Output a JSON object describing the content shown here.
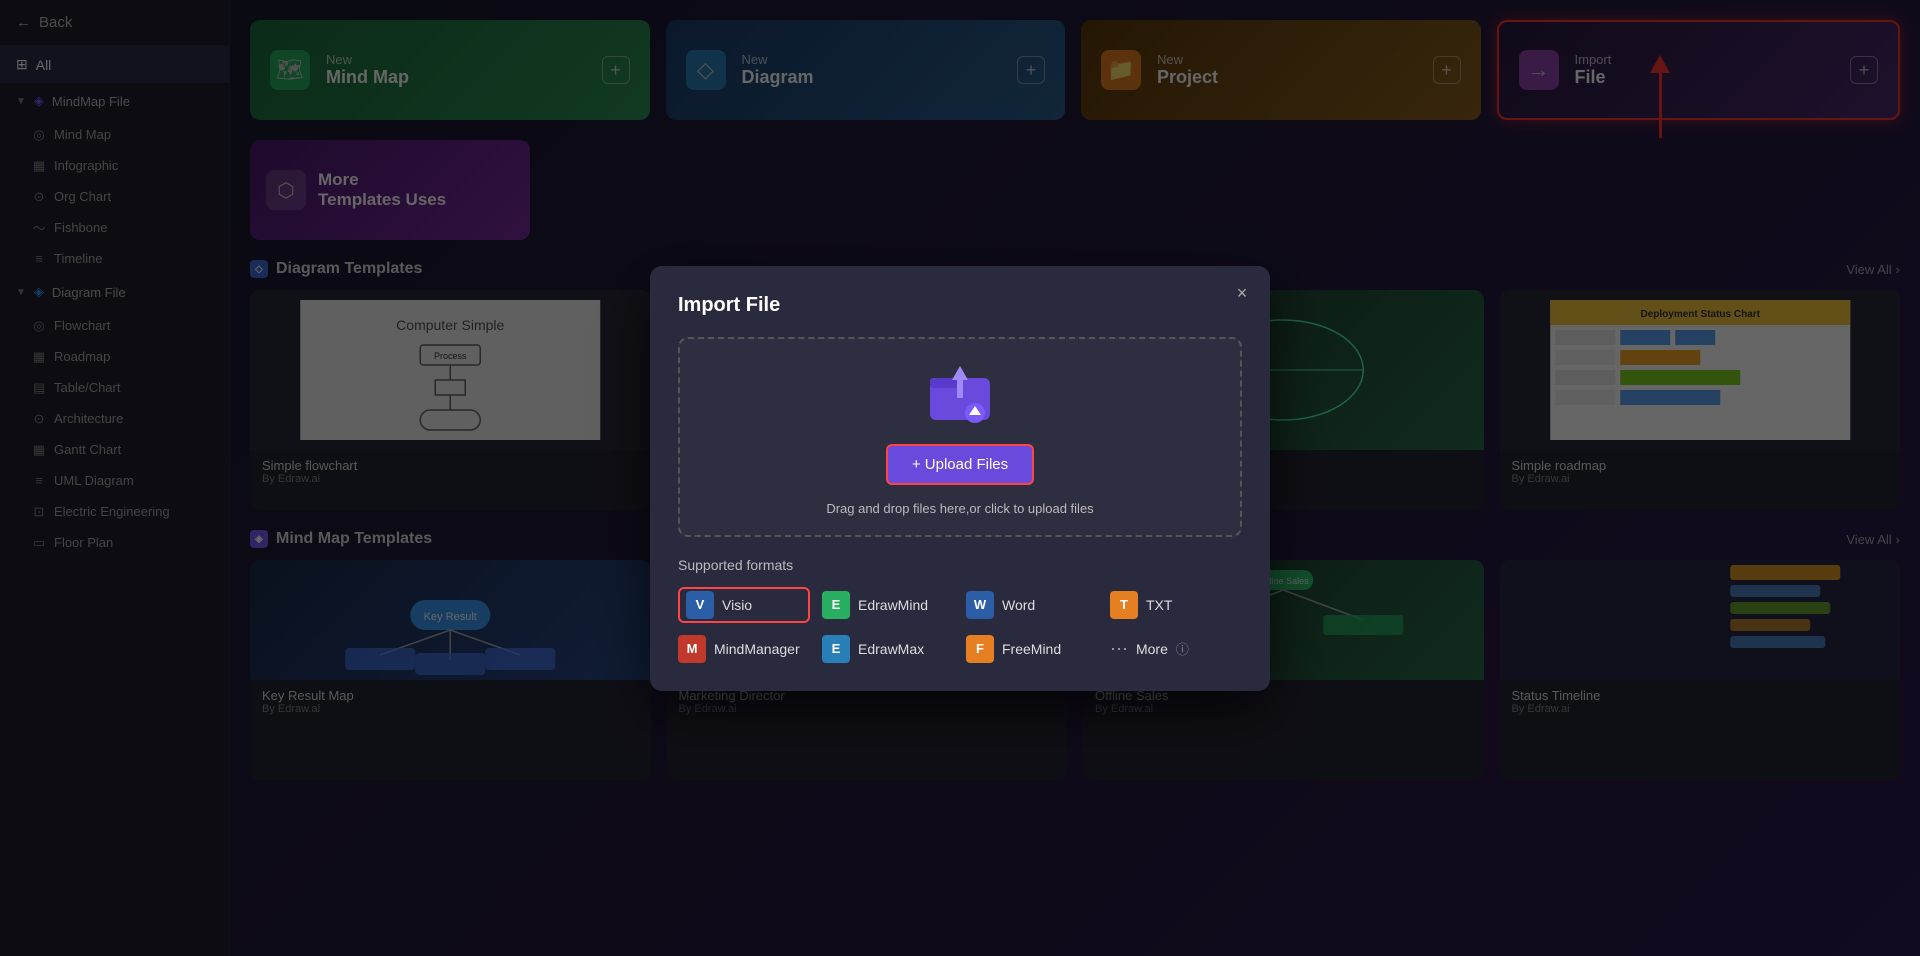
{
  "sidebar": {
    "back_label": "Back",
    "all_label": "All",
    "all_icon": "⊞",
    "mindmap_section": "MindMap File",
    "mindmap_items": [
      {
        "label": "Mind Map",
        "icon": "◎"
      },
      {
        "label": "Infographic",
        "icon": "▦"
      },
      {
        "label": "Org Chart",
        "icon": "⊙"
      },
      {
        "label": "Fishbone",
        "icon": "〜"
      },
      {
        "label": "Timeline",
        "icon": "≡"
      }
    ],
    "diagram_section": "Diagram File",
    "diagram_items": [
      {
        "label": "Flowchart",
        "icon": "◎"
      },
      {
        "label": "Roadmap",
        "icon": "▦"
      },
      {
        "label": "Table/Chart",
        "icon": "▤"
      },
      {
        "label": "Architecture",
        "icon": "⊙"
      },
      {
        "label": "Gantt Chart",
        "icon": "▦"
      },
      {
        "label": "UML Diagram",
        "icon": "≡"
      },
      {
        "label": "Electric Engineering",
        "icon": "⊡"
      },
      {
        "label": "Floor Plan",
        "icon": "▭"
      }
    ]
  },
  "top_cards": [
    {
      "icon": "🗺",
      "label": "New",
      "title": "Mind Map",
      "icon_class": "green"
    },
    {
      "icon": "◇",
      "label": "New",
      "title": "Diagram",
      "icon_class": "blue"
    },
    {
      "icon": "📁",
      "label": "New",
      "title": "Project",
      "icon_class": "orange"
    },
    {
      "icon": "→",
      "label": "Import",
      "title": "File",
      "icon_class": "purple"
    }
  ],
  "more_templates": {
    "icon": "⬡",
    "line1": "More",
    "line2": "Templates Uses"
  },
  "diagram_templates": {
    "section_title": "Diagram Templates",
    "view_all": "View All",
    "cards": [
      {
        "name": "Simple flowchart",
        "by": "By Edraw.ai"
      },
      {
        "name": "",
        "by": ""
      },
      {
        "name": "",
        "by": ""
      },
      {
        "name": "Simple roadmap",
        "by": "By Edraw.ai"
      }
    ]
  },
  "mindmap_templates": {
    "section_title": "Mind Map Templates",
    "view_all": "View All"
  },
  "modal": {
    "title": "Import File",
    "close": "×",
    "upload_btn": "+ Upload Files",
    "drag_hint": "Drag and drop files here,or click to upload files",
    "supported_label": "Supported formats",
    "formats": [
      {
        "name": "Visio",
        "class": "visio",
        "selected": true
      },
      {
        "name": "EdrawMind",
        "class": "edrawmind"
      },
      {
        "name": "Word",
        "class": "word"
      },
      {
        "name": "TXT",
        "class": "txt"
      },
      {
        "name": "MindManager",
        "class": "mindmanager"
      },
      {
        "name": "EdrawMax",
        "class": "edrawmax"
      },
      {
        "name": "FreeMind",
        "class": "freemind"
      },
      {
        "name": "More",
        "class": "more"
      }
    ]
  }
}
